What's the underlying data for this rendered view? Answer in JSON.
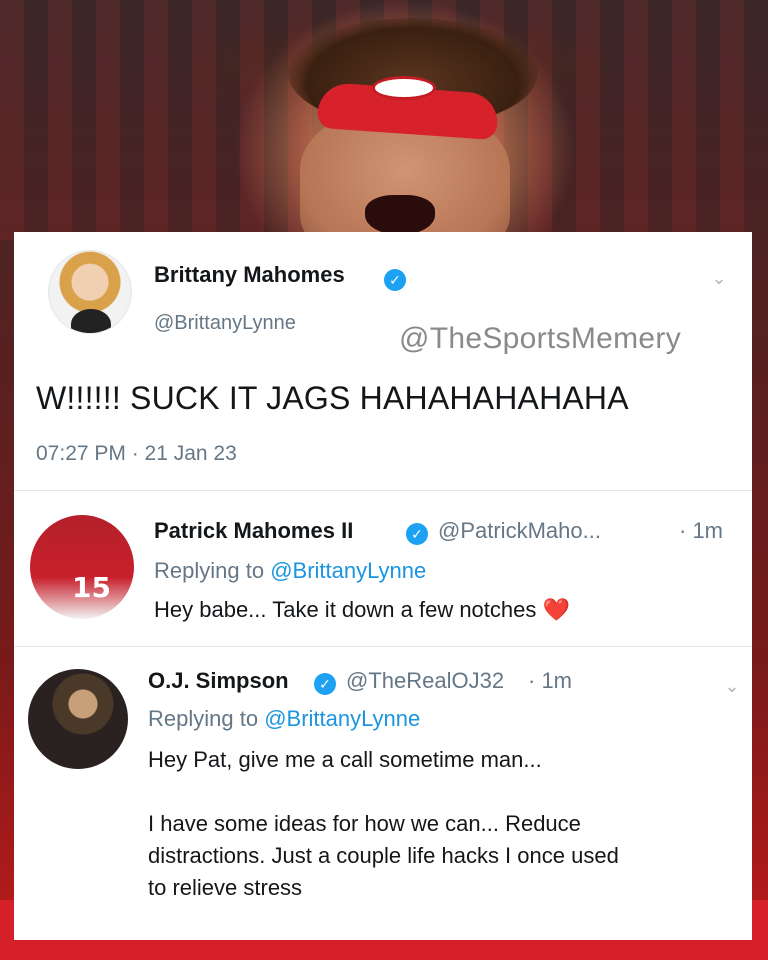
{
  "main_tweet": {
    "name": "Brittany Mahomes",
    "handle": "@BrittanyLynne",
    "watermark": "@TheSportsMemery",
    "text": "W!!!!!! SUCK IT JAGS HAHAHAHAHAHA",
    "timestamp": "07:27 PM · 21 Jan 23"
  },
  "replies": [
    {
      "name": "Patrick Mahomes II",
      "handle": "@PatrickMaho...",
      "time": "· 1m",
      "replying_prefix": "Replying to ",
      "replying_to": "@BrittanyLynne",
      "body": "Hey babe... Take it down a few notches",
      "emoji": "❤️"
    },
    {
      "name": "O.J. Simpson",
      "handle": "@TheRealOJ32",
      "time": "· 1m",
      "replying_prefix": "Replying to ",
      "replying_to": "@BrittanyLynne",
      "body_lines": [
        "Hey Pat, give me a call sometime man...",
        "",
        "I have some ideas for how we can... Reduce",
        "distractions. Just a couple life hacks I once used",
        "to relieve stress"
      ]
    }
  ],
  "icons": {
    "verified": "verified-badge-icon",
    "chevron": "chevron-down-icon"
  },
  "colors": {
    "verified_blue": "#1da1f2",
    "link_blue": "#1b95e0",
    "secondary_gray": "#657786",
    "heart_red": "#e0245e"
  }
}
